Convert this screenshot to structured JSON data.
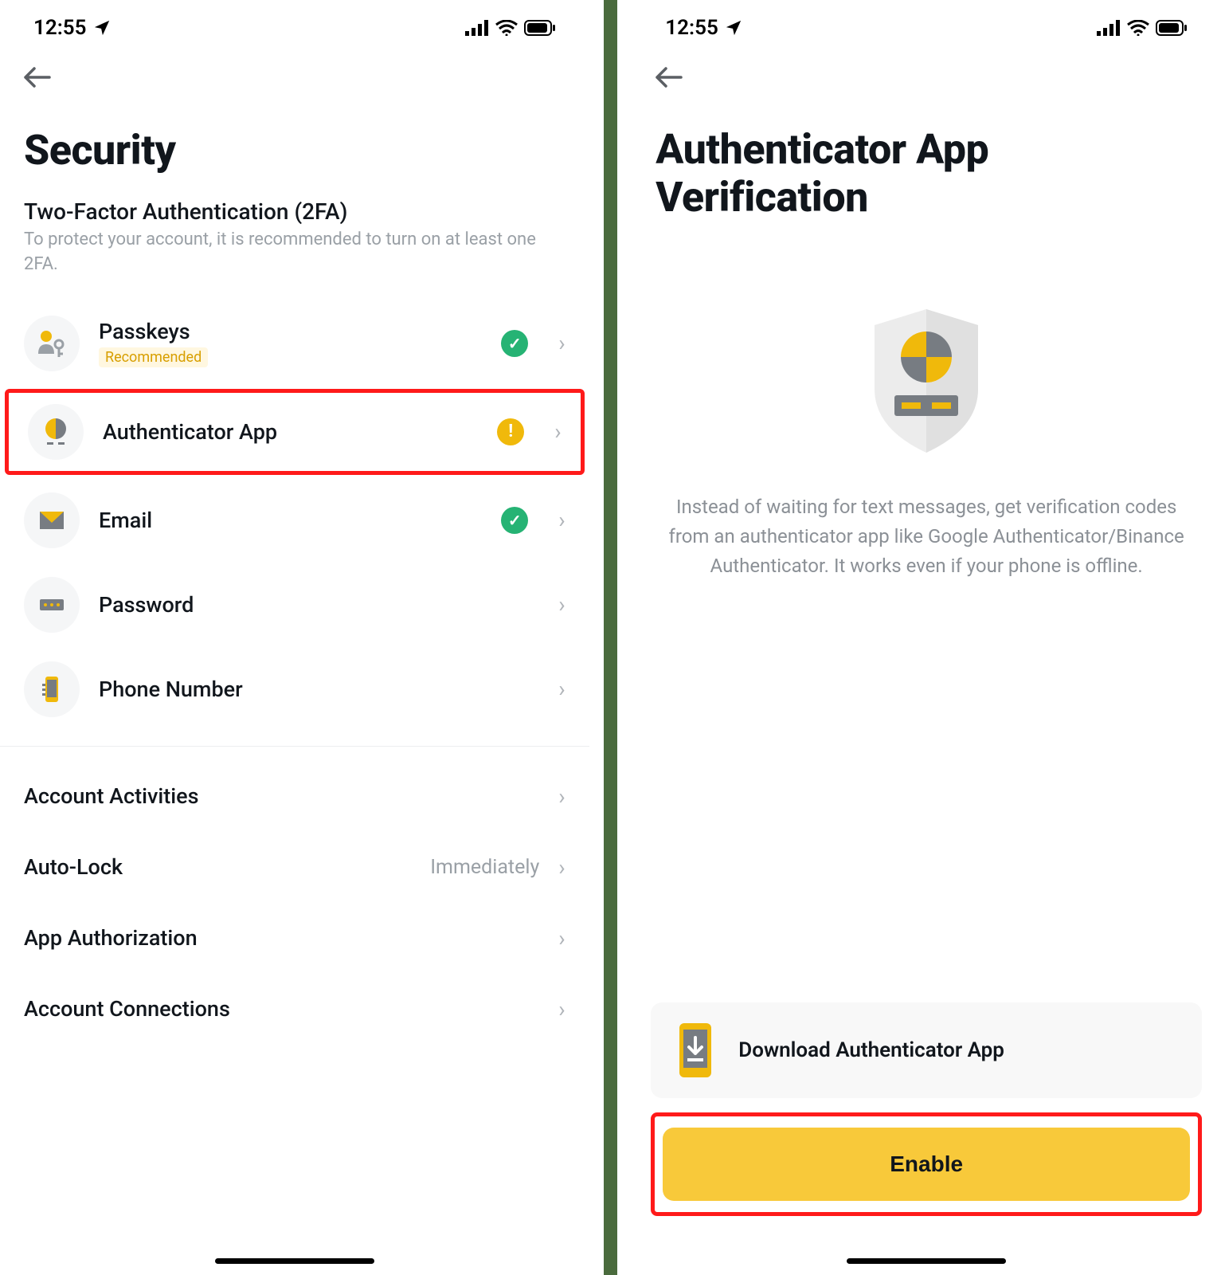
{
  "statusbar": {
    "time": "12:55"
  },
  "left": {
    "title": "Security",
    "section_title": "Two-Factor Authentication (2FA)",
    "section_sub": "To protect your account, it is recommended to turn on at least one 2FA.",
    "items": [
      {
        "label": "Passkeys",
        "badge": "Recommended"
      },
      {
        "label": "Authenticator App"
      },
      {
        "label": "Email"
      },
      {
        "label": "Password"
      },
      {
        "label": "Phone Number"
      }
    ],
    "other": [
      {
        "label": "Account Activities"
      },
      {
        "label": "Auto-Lock",
        "value": "Immediately"
      },
      {
        "label": "App Authorization"
      },
      {
        "label": "Account Connections"
      }
    ]
  },
  "right": {
    "title": "Authenticator App Verification",
    "description": "Instead of waiting for text messages, get verification codes from an authenticator app like Google Authenticator/Binance Authenticator. It works even if your phone is offline.",
    "download_label": "Download Authenticator App",
    "enable_label": "Enable"
  }
}
